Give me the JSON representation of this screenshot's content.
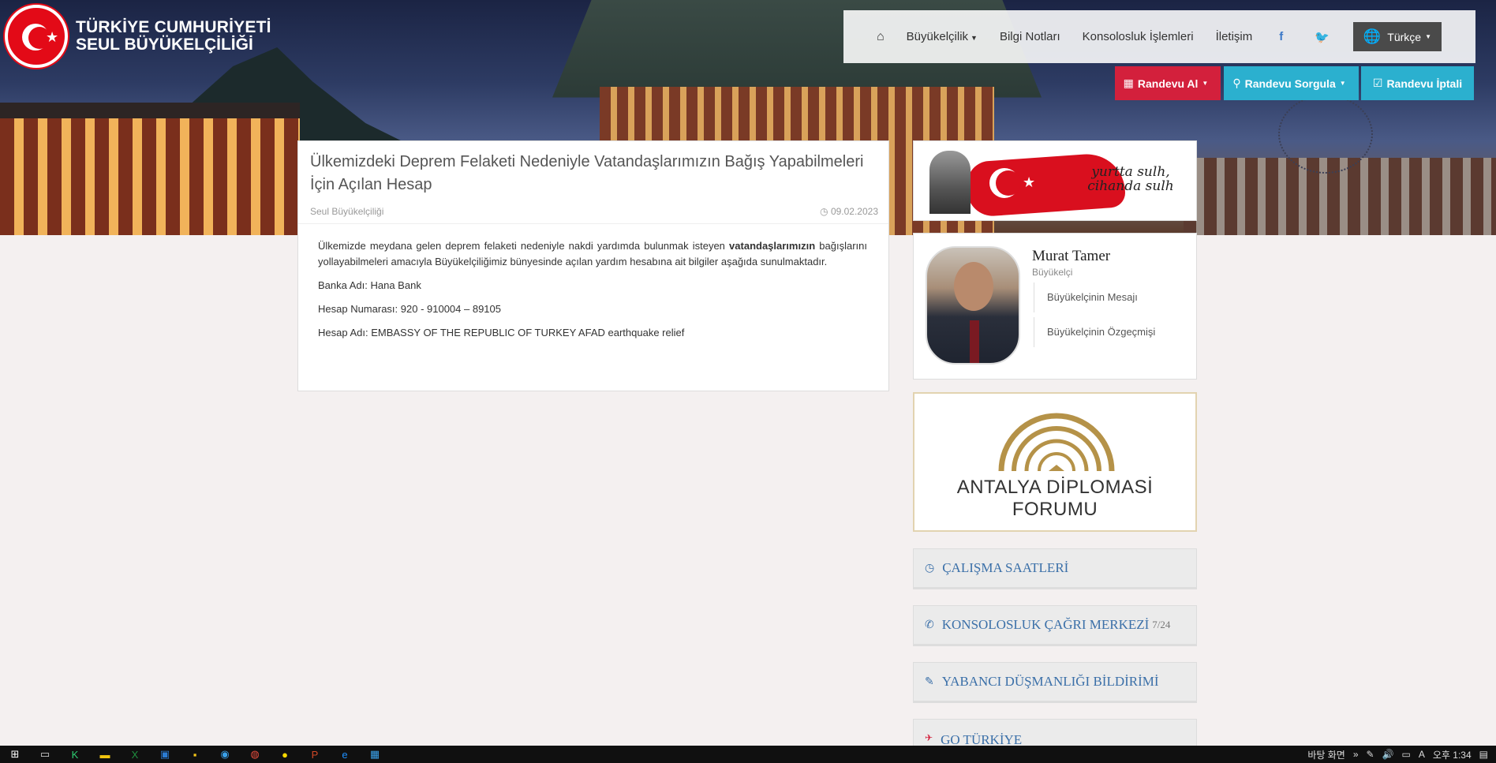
{
  "header": {
    "logo_line1": "TÜRKİYE CUMHURİYETİ",
    "logo_line2": "SEUL BÜYÜKELÇİLİĞİ"
  },
  "nav": {
    "home_icon": "home-icon",
    "buyukelcilik": "Büyükelçilik",
    "bilgi_notlari": "Bilgi Notları",
    "konsolosluk": "Konsolosluk İşlemleri",
    "iletisim": "İletişim",
    "facebook": "f",
    "twitter": "🐦",
    "language": "Türkçe"
  },
  "appointments": {
    "randevu_al": "Randevu Al",
    "randevu_sorgula": "Randevu Sorgula",
    "randevu_iptali": "Randevu İptali"
  },
  "article": {
    "title": "Ülkemizdeki Deprem Felaketi Nedeniyle Vatandaşlarımızın Bağış Yapabilmeleri İçin Açılan Hesap",
    "source": "Seul Büyükelçiliği",
    "date": "09.02.2023",
    "intro_before": "Ülkemizde meydana gelen deprem felaketi nedeniyle nakdi yardımda bulunmak isteyen ",
    "intro_bold": "vatandaşlarımızın",
    "intro_after": " bağışlarını yollayabilmeleri amacıyla Büyükelçiliğimiz bünyesinde açılan yardım hesabına ait bilgiler aşağıda sunulmaktadır.",
    "bank": "Banka Adı: Hana Bank",
    "account_no": "Hesap Numarası: 920 - 910004 – 89105",
    "account_name": "Hesap Adı: EMBASSY OF THE REPUBLIC OF TURKEY AFAD earthquake relief"
  },
  "sidebar": {
    "quote": "yurtta sulh, cihanda sulh",
    "ambassador_name": "Murat Tamer",
    "ambassador_role": "Büyükelçi",
    "link_mesaj": "Büyükelçinin Mesajı",
    "link_ozgecmis": "Büyükelçinin Özgeçmişi",
    "adf_line1": "ANTALYA DİPLOMASİ",
    "adf_line2": "FORUMU",
    "panels": {
      "calisma": "ÇALIŞMA SAATLERİ",
      "konsolosluk": "KONSOLOSLUK ÇAĞRI MERKEZİ",
      "konsolosluk_suffix": "7/24",
      "yabanci": "YABANCI DÜŞMANLIĞI BİLDİRİMİ",
      "go": "GO TÜRKİYE"
    }
  },
  "taskbar": {
    "desktop_label": "바탕 화면",
    "chevron": "»",
    "clock": "오후 1:34"
  },
  "colors": {
    "accent_red": "#d3203c",
    "accent_cyan": "#2bb0cf",
    "panel_blue": "#3a6fa8"
  }
}
